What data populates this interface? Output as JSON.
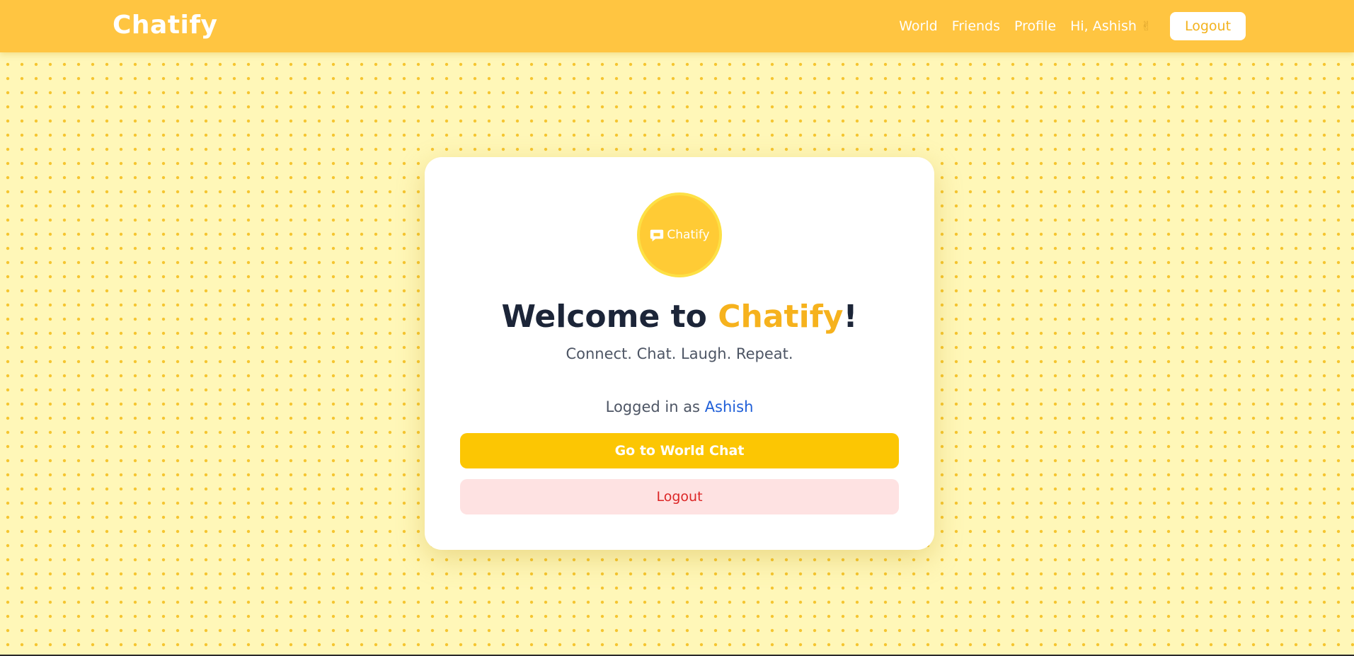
{
  "navbar": {
    "brand": "Chatify",
    "links": [
      "World",
      "Friends",
      "Profile"
    ],
    "greeting": "Hi, Ashish",
    "greeting_icon": "waving-hand-icon",
    "logout_label": "Logout"
  },
  "card": {
    "logo_text": "Chatify",
    "logo_icon": "chat-bubble-icon",
    "title_prefix": "Welcome to ",
    "title_accent": "Chatify",
    "title_suffix": "!",
    "subtitle": "Connect. Chat. Laugh. Repeat.",
    "logged_in_prefix": "Logged in as ",
    "username": "Ashish",
    "primary_button": "Go to World Chat",
    "logout_button": "Logout"
  },
  "colors": {
    "navbar": "#ffc541",
    "background": "#fff7b8",
    "dots": "#f5c531",
    "accent": "#f6b21d",
    "primary_button": "#fcc603",
    "danger_text": "#dc2626",
    "danger_bg": "#fee2e2",
    "link_blue": "#1f5fd8"
  }
}
